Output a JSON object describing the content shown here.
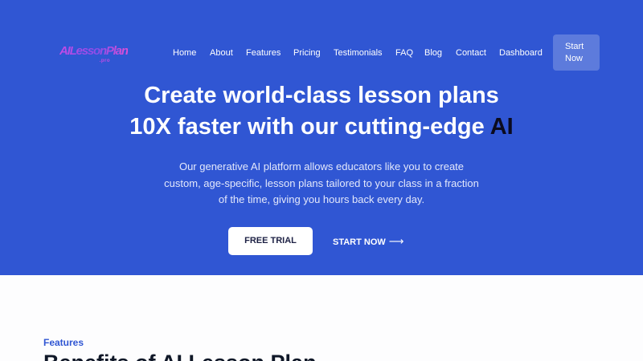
{
  "logo": {
    "text": "AILessonPlan",
    "sub": ".pro"
  },
  "nav": {
    "items": [
      {
        "label": "Home"
      },
      {
        "label": "About"
      },
      {
        "label": "Features"
      },
      {
        "label": "Pricing"
      },
      {
        "label": "Testimonials"
      },
      {
        "label": "FAQ"
      },
      {
        "label": "Blog"
      },
      {
        "label": "Contact"
      },
      {
        "label": "Dashboard"
      }
    ],
    "cta": {
      "line1": "Start",
      "line2": "Now"
    }
  },
  "hero": {
    "headline_line1": "Create world-class lesson plans",
    "headline_line2_prefix": "10X faster with our cutting-edge",
    "headline_line2_highlight": "AI",
    "subtext": "Our generative AI platform allows educators like you to create custom, age-specific, lesson plans tailored to your class in a fraction of the time, giving you hours back every day.",
    "primary_button": "FREE TRIAL",
    "secondary_button": "START NOW",
    "secondary_arrow": "⟶"
  },
  "features": {
    "label": "Features",
    "title": "Benefits of AI Lesson Plan"
  },
  "colors": {
    "hero_bg": "#3056d3",
    "accent": "#3056d3",
    "highlight_text": "#0b0b1e",
    "logo_gradient_start": "#c44be6",
    "logo_gradient_end": "#e04fd6"
  }
}
